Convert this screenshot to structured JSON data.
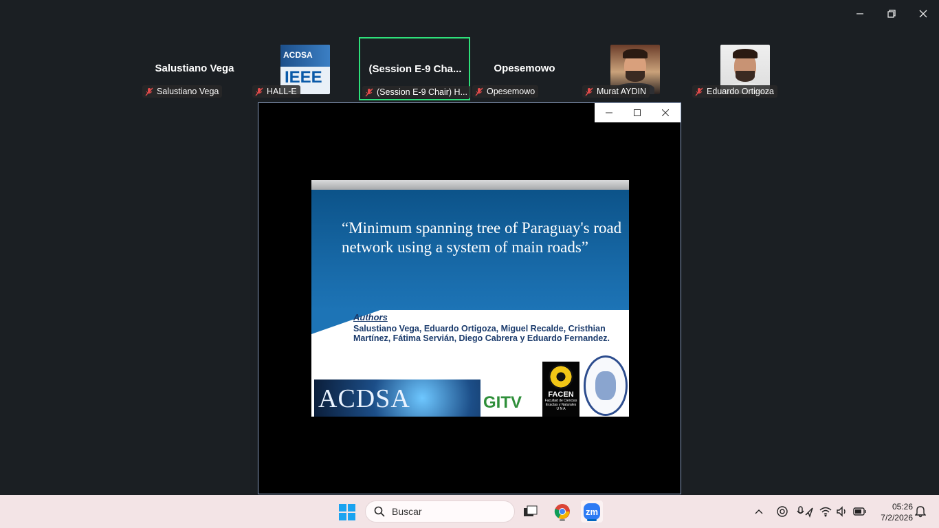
{
  "participants": [
    {
      "tile_name": "Salustiano Vega",
      "label": "Salustiano Vega"
    },
    {
      "tile_name": "",
      "label": "HALL-E",
      "logo_top": "ACDSA",
      "logo_bottom": "IEEE"
    },
    {
      "tile_name": "(Session  E-9  Cha...",
      "label": "(Session E-9 Chair) H..."
    },
    {
      "tile_name": "Opesemowo",
      "label": "Opesemowo"
    },
    {
      "tile_name": "",
      "label": "Murat AYDIN"
    },
    {
      "tile_name": "",
      "label": "Eduardo Ortigoza"
    }
  ],
  "slide": {
    "title": "“Minimum spanning tree of Paraguay's road network using a system of main roads”",
    "authors_heading": "Authors",
    "authors": "Salustiano Vega, Eduardo Ortigoza, Miguel Recalde, Cristhian Martínez, Fátima Servián, Diego Cabrera y Eduardo Fernandez.",
    "logo_acdsa": "ACDSA",
    "logo_gitv": "GITV",
    "logo_facen": "FACEN",
    "logo_facen_sub": "Facultad de Ciencias Exactas y Naturales",
    "logo_facen_una": "U N A"
  },
  "taskbar": {
    "search_placeholder": "Buscar",
    "time": "05:26",
    "date": "7/2/2026"
  },
  "colors": {
    "active_speaker_border": "#2ee07a",
    "zoom_blue": "#2d7bf4",
    "slide_blue": "#1768a6"
  }
}
